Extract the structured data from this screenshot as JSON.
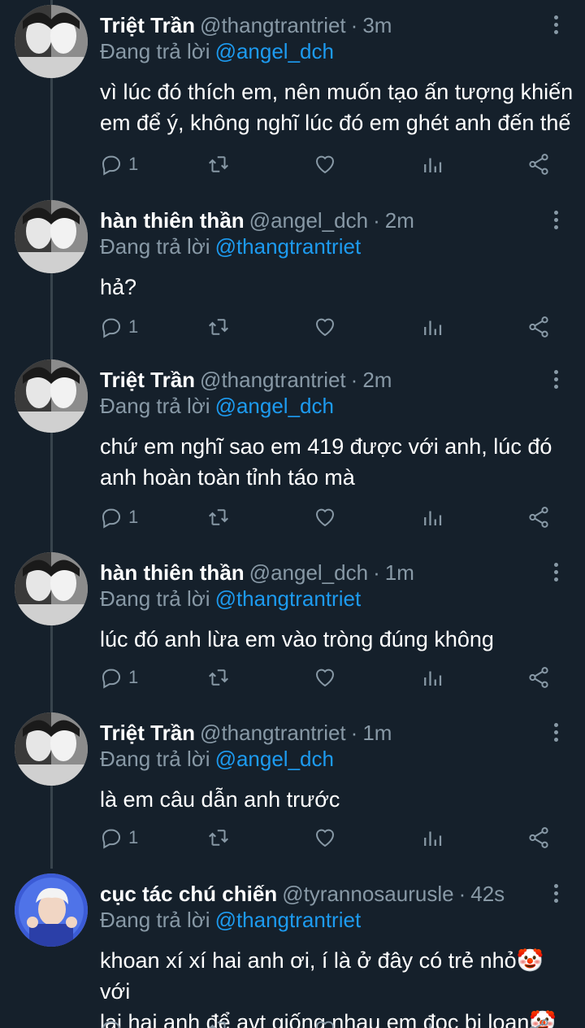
{
  "tweets": [
    {
      "name": "Triệt Trần",
      "handle": "@thangtrantriet",
      "dot": "·",
      "time": "3m",
      "replying_label": "Đang trả lời",
      "replying_to": "@angel_dch",
      "lines": [
        "vì lúc đó thích em, nên muốn tạo ấn tượng khiến",
        "em để ý, không nghĩ lúc đó em ghét anh đến thế"
      ],
      "reply_count": "1",
      "avatar": "grayscale-portrait"
    },
    {
      "name": "hàn thiên thần",
      "handle": "@angel_dch",
      "dot": "·",
      "time": "2m",
      "replying_label": "Đang trả lời",
      "replying_to": "@thangtrantriet",
      "lines": [
        "hả?"
      ],
      "reply_count": "1",
      "avatar": "grayscale-portrait"
    },
    {
      "name": "Triệt Trần",
      "handle": "@thangtrantriet",
      "dot": "·",
      "time": "2m",
      "replying_label": "Đang trả lời",
      "replying_to": "@angel_dch",
      "lines": [
        "chứ em nghĩ sao em 419 được với anh, lúc đó",
        "anh hoàn toàn tỉnh táo mà"
      ],
      "reply_count": "1",
      "avatar": "grayscale-portrait"
    },
    {
      "name": "hàn thiên thần",
      "handle": "@angel_dch",
      "dot": "·",
      "time": "1m",
      "replying_label": "Đang trả lời",
      "replying_to": "@thangtrantriet",
      "lines": [
        "lúc đó anh lừa em vào tròng đúng không"
      ],
      "reply_count": "1",
      "avatar": "grayscale-portrait"
    },
    {
      "name": "Triệt Trần",
      "handle": "@thangtrantriet",
      "dot": "·",
      "time": "1m",
      "replying_label": "Đang trả lời",
      "replying_to": "@angel_dch",
      "lines": [
        "là em câu dẫn anh trước"
      ],
      "reply_count": "1",
      "avatar": "grayscale-portrait"
    },
    {
      "name": "cục tác chú chiến",
      "handle": "@tyrannosaurusle",
      "dot": "·",
      "time": "42s",
      "replying_label": "Đang trả lời",
      "replying_to": "@thangtrantriet",
      "lines": [
        "khoan xí xí hai anh ơi, í là ở đây có trẻ nhỏ🤡 với",
        "lại hai anh để avt giống nhau em đọc bị loạn🤡"
      ],
      "reply_count": "",
      "avatar": "blue-portrait"
    }
  ],
  "icons": {
    "reply": "reply-icon",
    "retweet": "retweet-icon",
    "like": "heart-icon",
    "analytics": "analytics-icon",
    "share": "share-icon",
    "more": "more-vertical-icon"
  },
  "colors": {
    "background": "#15202b",
    "secondary_text": "#8899a6",
    "mention": "#1d9bf0",
    "thread_line": "#38444d"
  }
}
